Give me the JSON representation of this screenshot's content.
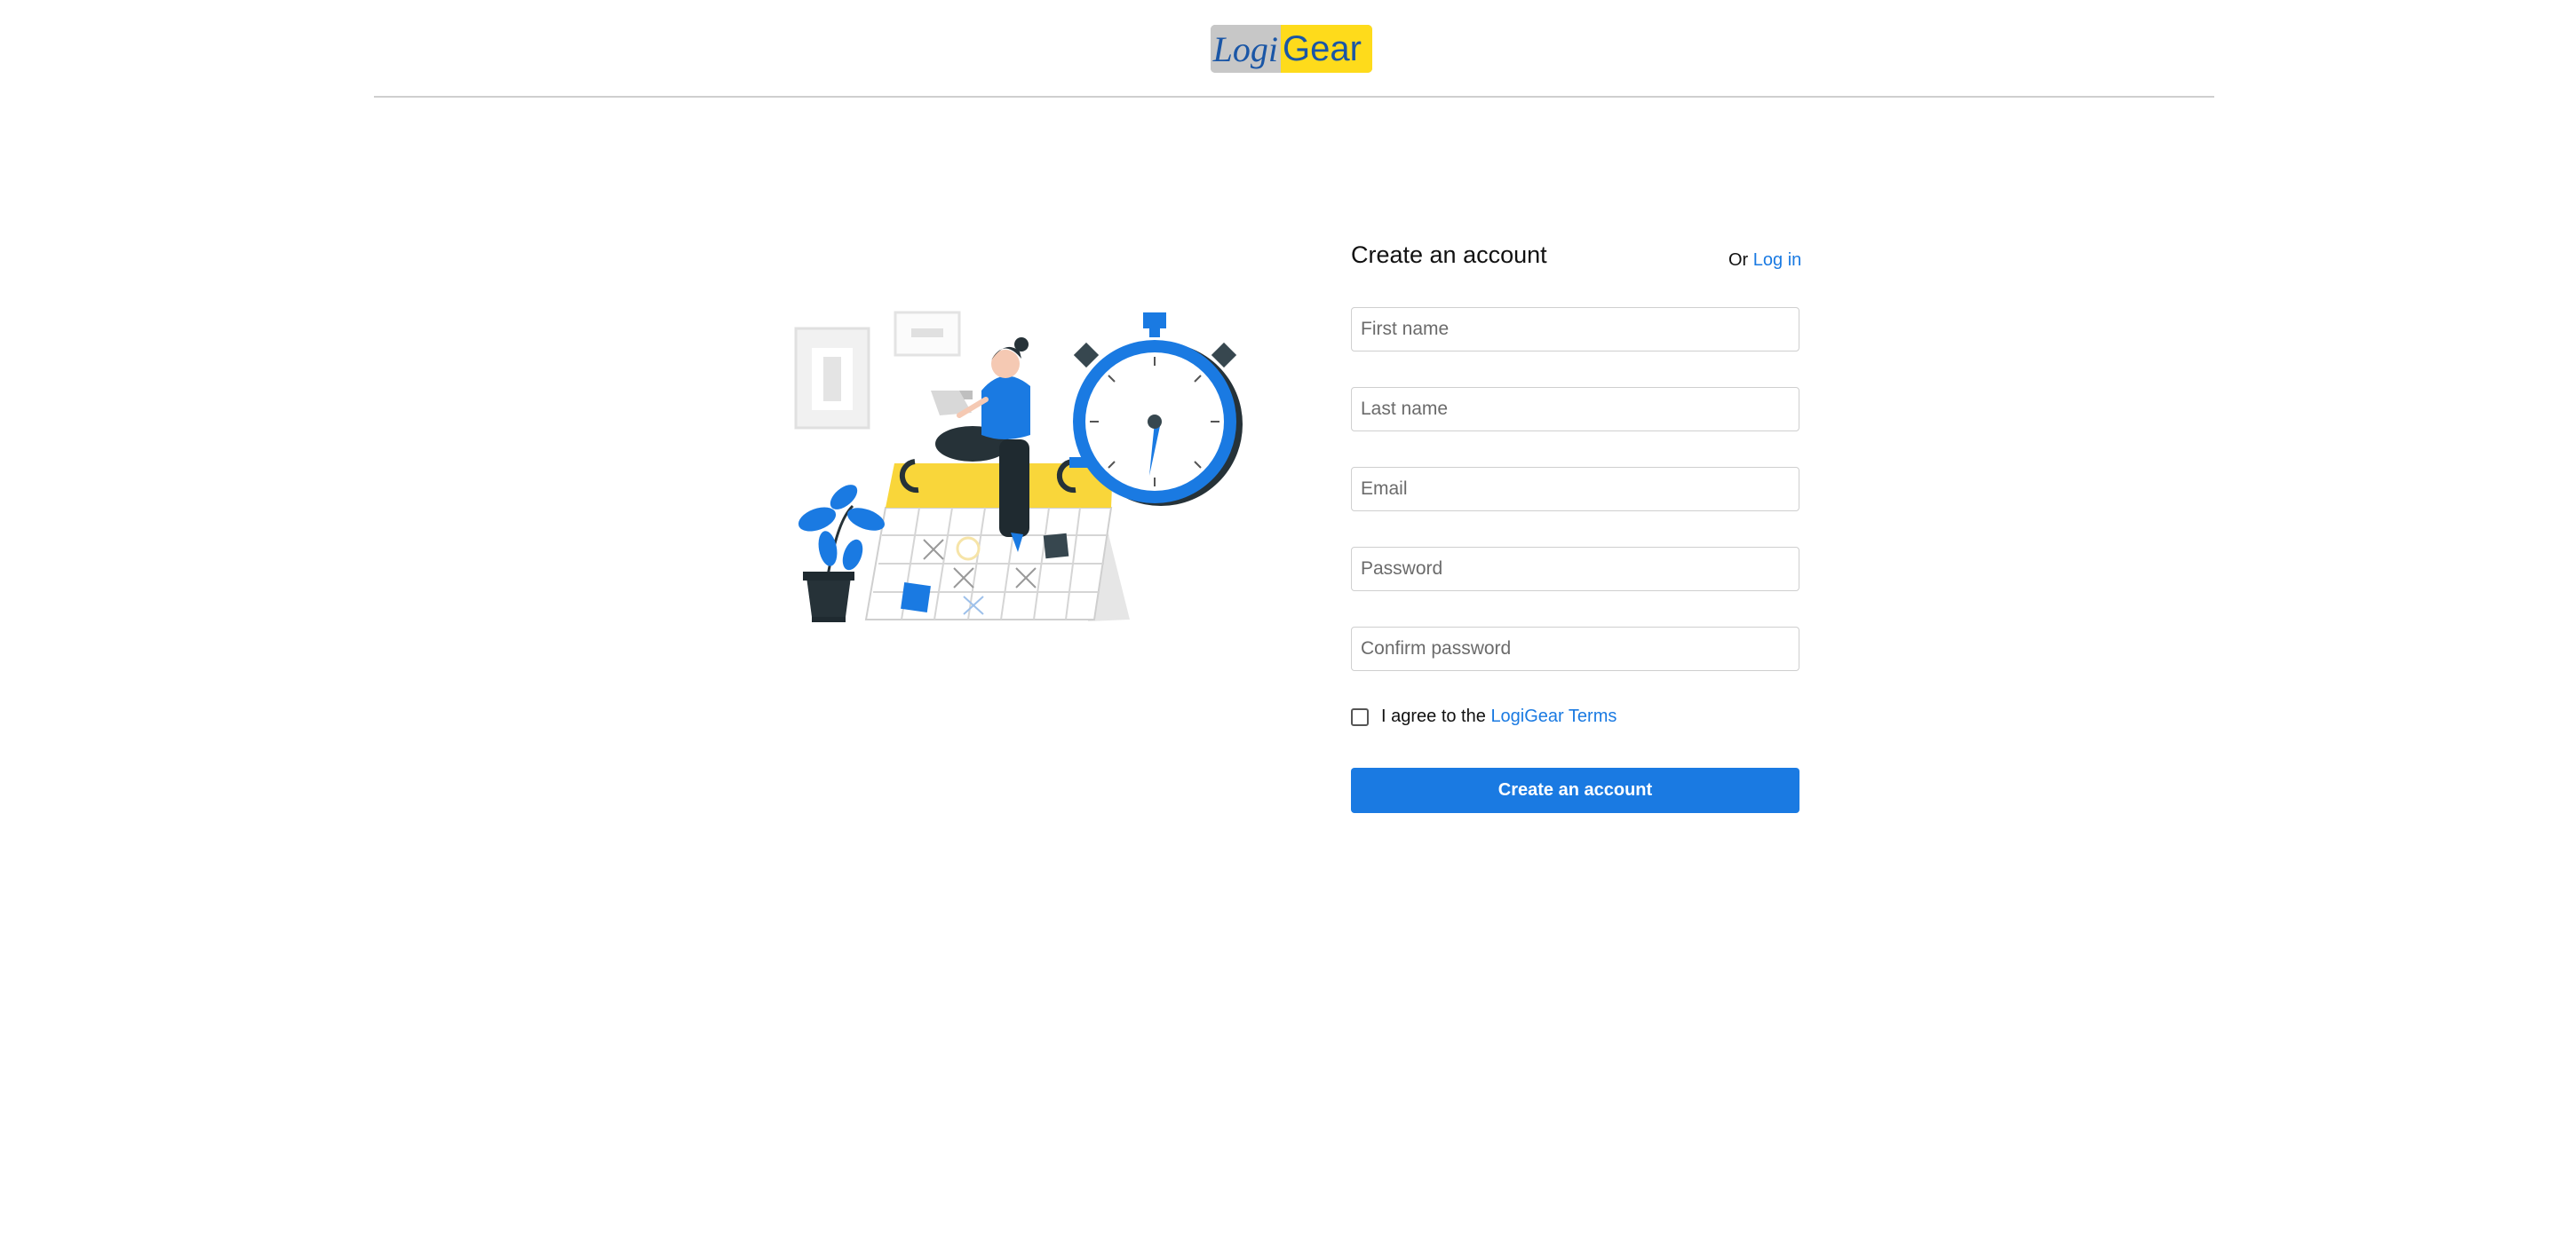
{
  "header": {
    "logo_left": "Logi",
    "logo_right": "Gear"
  },
  "form": {
    "title": "Create an account",
    "login_prefix": "Or",
    "login_link": "Log in",
    "fields": [
      {
        "placeholder": "First name",
        "value": ""
      },
      {
        "placeholder": "Last name",
        "value": ""
      },
      {
        "placeholder": "Email",
        "value": ""
      },
      {
        "placeholder": "Password",
        "value": ""
      },
      {
        "placeholder": "Confirm password",
        "value": ""
      }
    ],
    "terms_prefix": "I agree to the",
    "terms_link": "LogiGear Terms",
    "submit_label": "Create an account"
  },
  "colors": {
    "accent": "#1a7ae2",
    "logo_yellow": "#fedb1b",
    "logo_gray": "#c7c7c7"
  }
}
